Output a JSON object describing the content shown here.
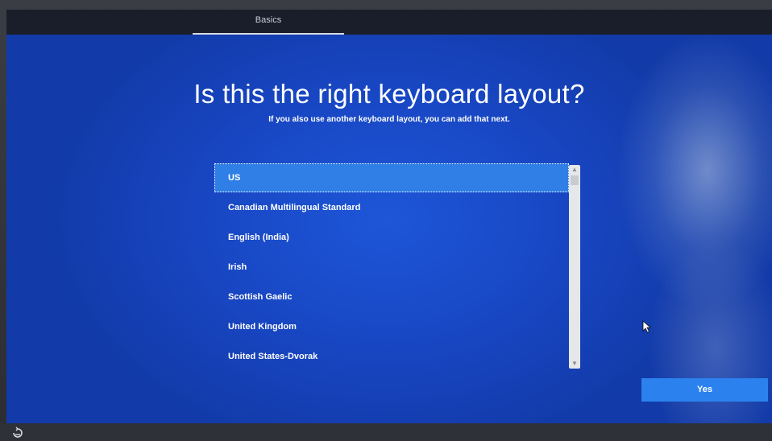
{
  "header": {
    "tab_label": "Basics"
  },
  "main": {
    "title": "Is this the right keyboard layout?",
    "subtitle": "If you also use another keyboard layout, you can add that next.",
    "layouts": [
      "US",
      "Canadian Multilingual Standard",
      "English (India)",
      "Irish",
      "Scottish Gaelic",
      "United Kingdom",
      "United States-Dvorak"
    ],
    "selected_layout": "US"
  },
  "footer": {
    "yes_label": "Yes",
    "accessibility_icon": "ease-of-access-icon"
  },
  "colors": {
    "background": "#1846c2",
    "selected_item": "#2f7fe6",
    "button": "#2b82ee",
    "topbar": "#1a1e2a"
  },
  "icons": {
    "scroll_up": "chevron-up-icon",
    "scroll_down": "chevron-down-icon",
    "cursor": "mouse-pointer-icon"
  }
}
